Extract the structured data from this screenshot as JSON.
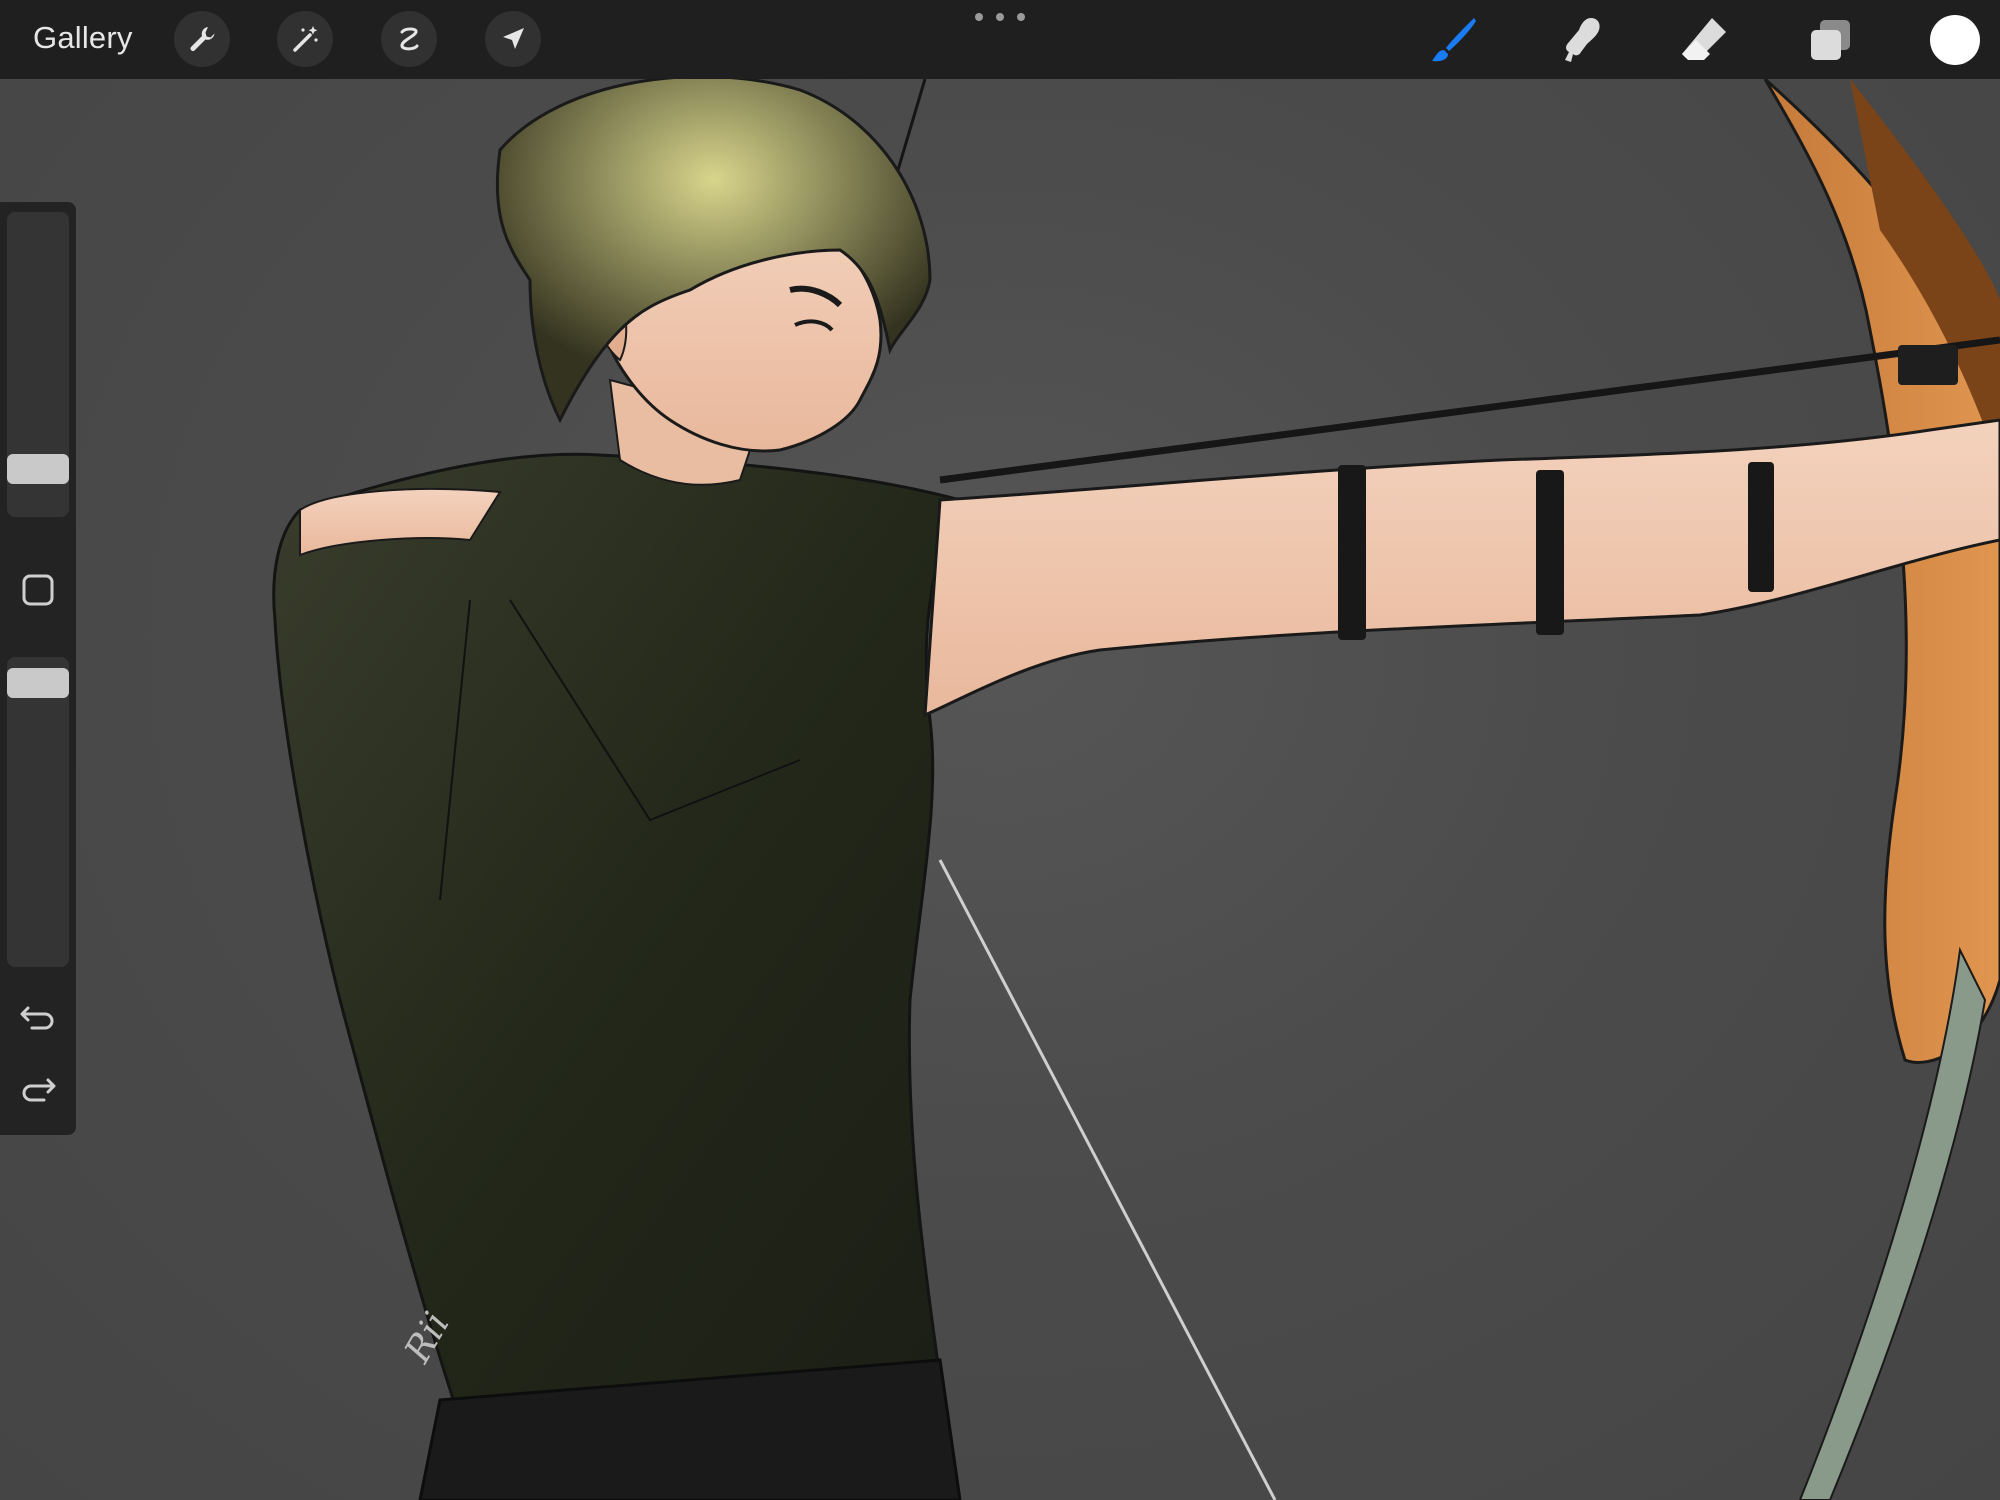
{
  "toolbar": {
    "gallery_label": "Gallery",
    "left_tools": [
      "wrench-icon",
      "magic-wand-icon",
      "selection-icon",
      "transform-arrow-icon"
    ],
    "right_tools": [
      "brush-icon",
      "smudge-icon",
      "eraser-icon",
      "layers-icon"
    ],
    "active_tool": "brush-icon",
    "active_color": "#1a7cf5",
    "current_color": "#ffffff",
    "more_menu": "more-dots-icon"
  },
  "sidebar": {
    "brush_size_level": 0.12,
    "opacity_level": 0.96,
    "modifier": "modifier-square-icon",
    "undo": "undo-icon",
    "redo": "redo-icon"
  },
  "canvas": {
    "background": "#4b4b4b",
    "artwork": "archer-drawing",
    "signature_text": "Rii"
  }
}
